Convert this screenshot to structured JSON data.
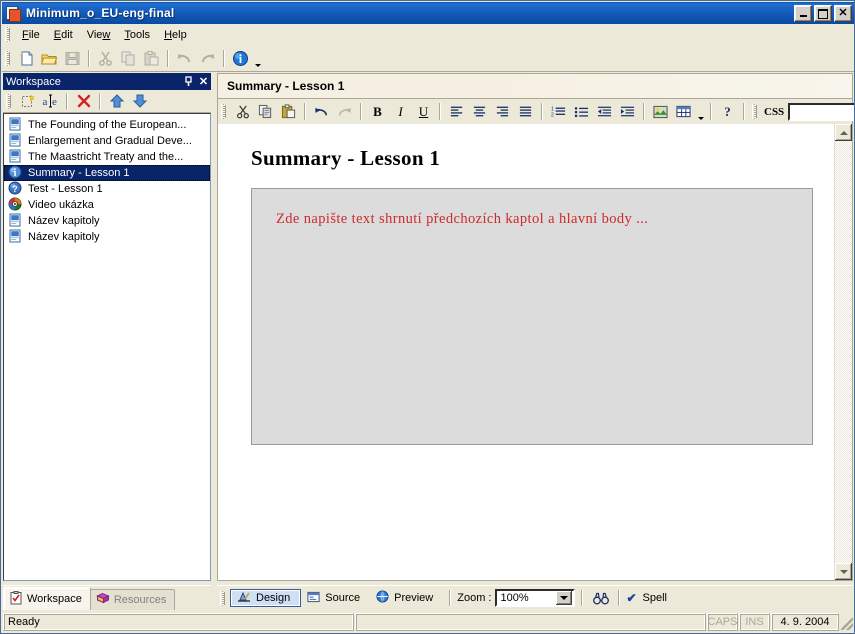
{
  "window": {
    "title": "Minimum_o_EU-eng-final",
    "icon": "document-app-icon",
    "buttons": {
      "minimize": "minimize-button",
      "maximize": "maximize-button",
      "close": "close-button"
    }
  },
  "menubar": {
    "items": [
      {
        "label": "File",
        "accel": "F"
      },
      {
        "label": "Edit",
        "accel": "E"
      },
      {
        "label": "View",
        "accel": "w"
      },
      {
        "label": "Tools",
        "accel": "T"
      },
      {
        "label": "Help",
        "accel": "H"
      }
    ]
  },
  "main_toolbar": {
    "buttons": [
      {
        "name": "new-icon",
        "enabled": true
      },
      {
        "name": "open-folder-icon",
        "enabled": true
      },
      {
        "name": "save-icon",
        "enabled": false
      },
      {
        "name": "cut-icon",
        "enabled": false
      },
      {
        "name": "copy-icon",
        "enabled": false
      },
      {
        "name": "paste-icon",
        "enabled": false
      },
      {
        "name": "undo-icon",
        "enabled": false
      },
      {
        "name": "redo-icon",
        "enabled": false
      },
      {
        "name": "info-icon",
        "enabled": true
      }
    ]
  },
  "workspace_panel": {
    "title": "Workspace",
    "pin": "pin-icon",
    "close": "close-icon",
    "toolbar": [
      {
        "name": "new-item-icon"
      },
      {
        "name": "rename-icon"
      },
      {
        "name": "delete-icon"
      },
      {
        "name": "move-up-icon"
      },
      {
        "name": "move-down-icon"
      }
    ],
    "tree": [
      {
        "label": "The Founding of the European...",
        "icon": "page-icon",
        "selected": false
      },
      {
        "label": "Enlargement and Gradual Deve...",
        "icon": "page-icon",
        "selected": false
      },
      {
        "label": "The Maastricht Treaty and the...",
        "icon": "page-icon",
        "selected": false
      },
      {
        "label": "Summary - Lesson 1",
        "icon": "info-circle-icon",
        "selected": true
      },
      {
        "label": "Test - Lesson 1",
        "icon": "question-circle-icon",
        "selected": false
      },
      {
        "label": "Video ukázka",
        "icon": "media-player-icon",
        "selected": false
      },
      {
        "label": "Název kapitoly",
        "icon": "page-icon",
        "selected": false
      },
      {
        "label": "Název kapitoly",
        "icon": "page-icon",
        "selected": false
      }
    ],
    "tabs": [
      {
        "label": "Workspace",
        "icon": "clipboard-check-icon",
        "active": true
      },
      {
        "label": "Resources",
        "icon": "books-icon",
        "active": false
      }
    ]
  },
  "editor": {
    "header_title": "Summary - Lesson 1",
    "toolbar": [
      {
        "name": "cut-icon",
        "enabled": true
      },
      {
        "name": "copy-icon",
        "enabled": true
      },
      {
        "name": "paste-icon",
        "enabled": true
      },
      {
        "name": "undo-icon",
        "enabled": true
      },
      {
        "name": "redo-icon",
        "enabled": false
      },
      {
        "name": "bold-icon",
        "label": "B",
        "enabled": true
      },
      {
        "name": "italic-icon",
        "label": "I",
        "enabled": true
      },
      {
        "name": "underline-icon",
        "label": "U",
        "enabled": true
      },
      {
        "name": "align-left-icon",
        "enabled": true
      },
      {
        "name": "align-center-icon",
        "enabled": true
      },
      {
        "name": "align-right-icon",
        "enabled": true
      },
      {
        "name": "align-justify-icon",
        "enabled": true
      },
      {
        "name": "numbered-list-icon",
        "enabled": true
      },
      {
        "name": "bullet-list-icon",
        "enabled": true
      },
      {
        "name": "outdent-icon",
        "enabled": true
      },
      {
        "name": "indent-icon",
        "enabled": true
      },
      {
        "name": "insert-image-icon",
        "enabled": true
      },
      {
        "name": "insert-table-icon",
        "enabled": true
      },
      {
        "name": "help-icon",
        "label": "?",
        "enabled": true
      },
      {
        "name": "link-icon",
        "enabled": true
      }
    ],
    "css_label": "CSS",
    "css_value": "",
    "css_placeholder": "",
    "document": {
      "title": "Summary - Lesson 1",
      "body_text": "Zde napište text shrnutí předchozích kaptol a hlavní body ...",
      "body_text_color": "#cc2b2b",
      "box_background": "#dcdcdc"
    }
  },
  "view_bar": {
    "tabs": [
      {
        "label": "Design",
        "icon": "design-icon",
        "active": true
      },
      {
        "label": "Source",
        "icon": "source-icon",
        "active": false
      },
      {
        "label": "Preview",
        "icon": "globe-icon",
        "active": false
      }
    ],
    "zoom_label": "Zoom :",
    "zoom_value": "100%",
    "find_icon": "binoculars-icon",
    "spell_label": "Spell",
    "spell_checked": true
  },
  "status_bar": {
    "message": "Ready",
    "caps": "CAPS",
    "ins": "INS",
    "date": "4. 9. 2004"
  },
  "colors": {
    "titlebar_blue": "#0a52a8",
    "panel_header_blue": "#0a246a",
    "face": "#ece9d8",
    "selection_blue": "#0a246a",
    "accent_red": "#cc2b2b"
  }
}
